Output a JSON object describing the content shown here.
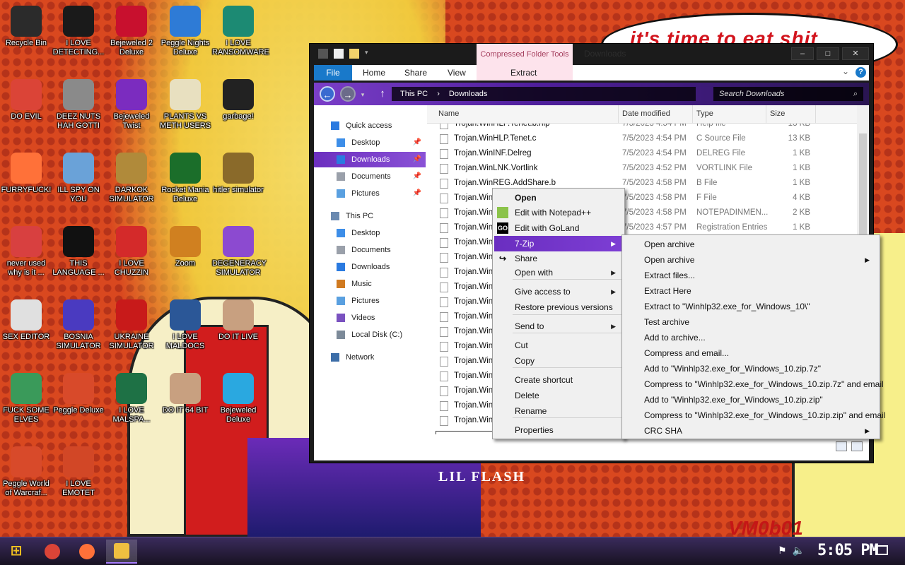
{
  "wallpaper": {
    "speech_bubble": "it's time to eat shit",
    "album_title": "LIL FLASH",
    "watermark": "VM0b01"
  },
  "desktop_icons": [
    {
      "label": "Recycle Bin",
      "icon": "recycle-bin-icon",
      "color": "#2b2b2b"
    },
    {
      "label": "I LOVE DETECTING...",
      "icon": "detect-it-easy-icon",
      "color": "#1a1a1a"
    },
    {
      "label": "Bejeweled 2 Deluxe",
      "icon": "bejeweled-icon",
      "color": "#c8102e"
    },
    {
      "label": "Peggle Nights Deluxe",
      "icon": "peggle-icon",
      "color": "#2e7bd6"
    },
    {
      "label": "I LOVE RANSOMWARE",
      "icon": "publisher-icon",
      "color": "#1c8a73"
    },
    {
      "label": "DO EVIL",
      "icon": "chrome-icon",
      "color": "#db4437"
    },
    {
      "label": "DEEZ NUTS HAH GOTTI",
      "icon": "windows-copy-icon",
      "color": "#8a8a8a"
    },
    {
      "label": "Bejeweled Twist",
      "icon": "bejeweled-twist-icon",
      "color": "#7b2cbf"
    },
    {
      "label": "PLANTS VS METH USERS",
      "icon": "plants-icon",
      "color": "#e8e0c0"
    },
    {
      "label": "garbage!",
      "icon": "skull-icon",
      "color": "#222222"
    },
    {
      "label": "FURRYFUCK!",
      "icon": "firefox-icon",
      "color": "#ff7139"
    },
    {
      "label": "ILL SPY ON YOU",
      "icon": "spy-icon",
      "color": "#6aa2d8"
    },
    {
      "label": "DARKOK SIMULATOR",
      "icon": "money-bag-icon",
      "color": "#b08a3a"
    },
    {
      "label": "Rocket Mania Deluxe",
      "icon": "rocket-icon",
      "color": "#1b6e2a"
    },
    {
      "label": "hitler simulator",
      "icon": "coin-icon",
      "color": "#8a6a2a"
    },
    {
      "label": "never used why is it ...",
      "icon": "devcpp-icon",
      "color": "#d84040"
    },
    {
      "label": "THIS LANGUAGE ...",
      "icon": "goland-icon",
      "color": "#111111"
    },
    {
      "label": "I LOVE CHUZZIN",
      "icon": "chuzzle-icon",
      "color": "#d42a2a"
    },
    {
      "label": "Zoom",
      "icon": "zoom-icon",
      "color": "#d08020"
    },
    {
      "label": "DEGENERACY SIMULATOR",
      "icon": "visual-studio-icon",
      "color": "#8c4ad0"
    },
    {
      "label": "SEX EDITOR",
      "icon": "hxd-icon",
      "color": "#e0e0e0"
    },
    {
      "label": "BOSNIA SIMULATOR",
      "icon": "mine-icon",
      "color": "#4a3ac0"
    },
    {
      "label": "UKRAINE SIMULATOR",
      "icon": "radiation-icon",
      "color": "#c81a1a"
    },
    {
      "label": "I LOVE MALDOCS",
      "icon": "word-icon",
      "color": "#2b5797"
    },
    {
      "label": "DO IT LIVE",
      "icon": "portrait-icon",
      "color": "#c8a080"
    },
    {
      "label": "FUCK SOME ELVES",
      "icon": "elf-icon",
      "color": "#3a9a5a"
    },
    {
      "label": "Peggle Deluxe",
      "icon": "peggle-deluxe-icon",
      "color": "#d84a2a"
    },
    {
      "label": "I LOVE MALSPA...",
      "icon": "excel-icon",
      "color": "#1e7145"
    },
    {
      "label": "DO IT 64 BIT",
      "icon": "portrait-64-icon",
      "color": "#c8a080"
    },
    {
      "label": "Bejeweled Deluxe",
      "icon": "diamond-icon",
      "color": "#2aa8e0"
    },
    {
      "label": "Peggle World of Warcraf...",
      "icon": "peggle-wow-icon",
      "color": "#d84a2a"
    },
    {
      "label": "I LOVE EMOTET",
      "icon": "powerpoint-icon",
      "color": "#d24726"
    }
  ],
  "explorer": {
    "title": "Downloads",
    "contextual_tab_group": "Compressed Folder Tools",
    "ribbon_tabs": [
      "File",
      "Home",
      "Share",
      "View",
      "Extract"
    ],
    "help": "?",
    "breadcrumb": [
      "This PC",
      "Downloads"
    ],
    "search_placeholder": "Search Downloads",
    "window_buttons": {
      "minimize": "–",
      "maximize": "□",
      "close": "✕"
    },
    "nav_pane": [
      {
        "label": "Quick access",
        "icon": "star-icon",
        "pinned": false,
        "selected": false
      },
      {
        "label": "Desktop",
        "icon": "desktop-icon",
        "pinned": true,
        "selected": false
      },
      {
        "label": "Downloads",
        "icon": "downloads-icon",
        "pinned": true,
        "selected": true
      },
      {
        "label": "Documents",
        "icon": "documents-icon",
        "pinned": true,
        "selected": false
      },
      {
        "label": "Pictures",
        "icon": "pictures-icon",
        "pinned": true,
        "selected": false
      },
      {
        "label": "This PC",
        "icon": "computer-icon",
        "pinned": false,
        "selected": false
      },
      {
        "label": "Desktop",
        "icon": "desktop-icon",
        "pinned": false,
        "selected": false
      },
      {
        "label": "Documents",
        "icon": "documents-icon",
        "pinned": false,
        "selected": false
      },
      {
        "label": "Downloads",
        "icon": "downloads-icon",
        "pinned": false,
        "selected": false
      },
      {
        "label": "Music",
        "icon": "music-icon",
        "pinned": false,
        "selected": false
      },
      {
        "label": "Pictures",
        "icon": "pictures-icon",
        "pinned": false,
        "selected": false
      },
      {
        "label": "Videos",
        "icon": "videos-icon",
        "pinned": false,
        "selected": false
      },
      {
        "label": "Local Disk (C:)",
        "icon": "disk-icon",
        "pinned": false,
        "selected": false
      },
      {
        "label": "Network",
        "icon": "network-icon",
        "pinned": false,
        "selected": false
      }
    ],
    "columns": [
      "Name",
      "Date modified",
      "Type",
      "Size"
    ],
    "files": [
      {
        "name": "Trojan.WinHLP.Tenet.b.hlp",
        "date": "7/5/2023 4:54 PM",
        "type": "Help file",
        "size": "13 KB"
      },
      {
        "name": "Trojan.WinHLP.Tenet.c",
        "date": "7/5/2023 4:54 PM",
        "type": "C Source File",
        "size": "13 KB"
      },
      {
        "name": "Trojan.WinINF.Delreg",
        "date": "7/5/2023 4:54 PM",
        "type": "DELREG File",
        "size": "1 KB"
      },
      {
        "name": "Trojan.WinLNK.Vortlink",
        "date": "7/5/2023 4:52 PM",
        "type": "VORTLINK File",
        "size": "1 KB"
      },
      {
        "name": "Trojan.WinREG.AddShare.b",
        "date": "7/5/2023 4:58 PM",
        "type": "B File",
        "size": "1 KB"
      },
      {
        "name": "Trojan.Winl",
        "date": "7/5/2023 4:58 PM",
        "type": "F File",
        "size": "4 KB"
      },
      {
        "name": "Trojan.Winl",
        "date": "7/5/2023 4:58 PM",
        "type": "NOTEPADINMEN...",
        "size": "2 KB"
      },
      {
        "name": "Trojan.Winl",
        "date": "7/5/2023 4:57 PM",
        "type": "Registration Entries",
        "size": "1 KB"
      },
      {
        "name": "Trojan.Winl",
        "date": "",
        "type": "",
        "size": ""
      },
      {
        "name": "Trojan.Winl",
        "date": "",
        "type": "",
        "size": ""
      },
      {
        "name": "Trojan.Winl",
        "date": "",
        "type": "",
        "size": ""
      },
      {
        "name": "Trojan.Winl",
        "date": "",
        "type": "",
        "size": ""
      },
      {
        "name": "Trojan.Winl",
        "date": "",
        "type": "",
        "size": ""
      },
      {
        "name": "Trojan.Winl",
        "date": "",
        "type": "",
        "size": ""
      },
      {
        "name": "Trojan.Winl",
        "date": "",
        "type": "",
        "size": ""
      },
      {
        "name": "Trojan.Winl",
        "date": "",
        "type": "",
        "size": ""
      },
      {
        "name": "Trojan.Winl",
        "date": "",
        "type": "",
        "size": ""
      },
      {
        "name": "Trojan.Winl",
        "date": "",
        "type": "",
        "size": ""
      },
      {
        "name": "Trojan.Winl",
        "date": "",
        "type": "",
        "size": ""
      },
      {
        "name": "Trojan.Winl",
        "date": "",
        "type": "",
        "size": ""
      },
      {
        "name": "Trojan.Winl",
        "date": "",
        "type": "",
        "size": ""
      },
      {
        "name": "Winhlp32.exe_for_Windows_10.zip",
        "date": "",
        "type": "",
        "size": ""
      }
    ]
  },
  "context_menu": [
    {
      "label": "Open",
      "bold": true,
      "arrow": false,
      "icon": "",
      "highlight": false
    },
    {
      "label": "Edit with Notepad++",
      "bold": false,
      "arrow": false,
      "icon": "notepadpp-icon",
      "highlight": false
    },
    {
      "label": "Edit with GoLand",
      "bold": false,
      "arrow": false,
      "icon": "goland-icon",
      "highlight": false
    },
    {
      "label": "7-Zip",
      "bold": false,
      "arrow": true,
      "icon": "",
      "highlight": true
    },
    {
      "label": "Share",
      "bold": false,
      "arrow": false,
      "icon": "share-icon",
      "highlight": false
    },
    {
      "label": "Open with",
      "bold": false,
      "arrow": true,
      "icon": "",
      "highlight": false
    },
    {
      "label": "Give access to",
      "bold": false,
      "arrow": true,
      "icon": "",
      "highlight": false
    },
    {
      "label": "Restore previous versions",
      "bold": false,
      "arrow": false,
      "icon": "",
      "highlight": false
    },
    {
      "label": "Send to",
      "bold": false,
      "arrow": true,
      "icon": "",
      "highlight": false
    },
    {
      "label": "Cut",
      "bold": false,
      "arrow": false,
      "icon": "",
      "highlight": false
    },
    {
      "label": "Copy",
      "bold": false,
      "arrow": false,
      "icon": "",
      "highlight": false
    },
    {
      "label": "Create shortcut",
      "bold": false,
      "arrow": false,
      "icon": "",
      "highlight": false
    },
    {
      "label": "Delete",
      "bold": false,
      "arrow": false,
      "icon": "",
      "highlight": false
    },
    {
      "label": "Rename",
      "bold": false,
      "arrow": false,
      "icon": "",
      "highlight": false
    },
    {
      "label": "Properties",
      "bold": false,
      "arrow": false,
      "icon": "",
      "highlight": false
    }
  ],
  "submenu_7zip": [
    {
      "label": "Open archive",
      "arrow": false
    },
    {
      "label": "Open archive",
      "arrow": true
    },
    {
      "label": "Extract files...",
      "arrow": false
    },
    {
      "label": "Extract Here",
      "arrow": false
    },
    {
      "label": "Extract to \"Winhlp32.exe_for_Windows_10\\\"",
      "arrow": false
    },
    {
      "label": "Test archive",
      "arrow": false
    },
    {
      "label": "Add to archive...",
      "arrow": false
    },
    {
      "label": "Compress and email...",
      "arrow": false
    },
    {
      "label": "Add to \"Winhlp32.exe_for_Windows_10.zip.7z\"",
      "arrow": false
    },
    {
      "label": "Compress to \"Winhlp32.exe_for_Windows_10.zip.7z\" and email",
      "arrow": false
    },
    {
      "label": "Add to \"Winhlp32.exe_for_Windows_10.zip.zip\"",
      "arrow": false
    },
    {
      "label": "Compress to \"Winhlp32.exe_for_Windows_10.zip.zip\" and email",
      "arrow": false
    },
    {
      "label": "CRC SHA",
      "arrow": true
    }
  ],
  "taskbar": {
    "start_icon": "start-logo-icon",
    "apps": [
      {
        "name": "chrome-taskbar-icon",
        "color": "#db4437",
        "active": false
      },
      {
        "name": "firefox-taskbar-icon",
        "color": "#ff7139",
        "active": false
      },
      {
        "name": "file-explorer-taskbar-icon",
        "color": "#f0c040",
        "active": true
      }
    ],
    "clock": "5:05 PM"
  }
}
